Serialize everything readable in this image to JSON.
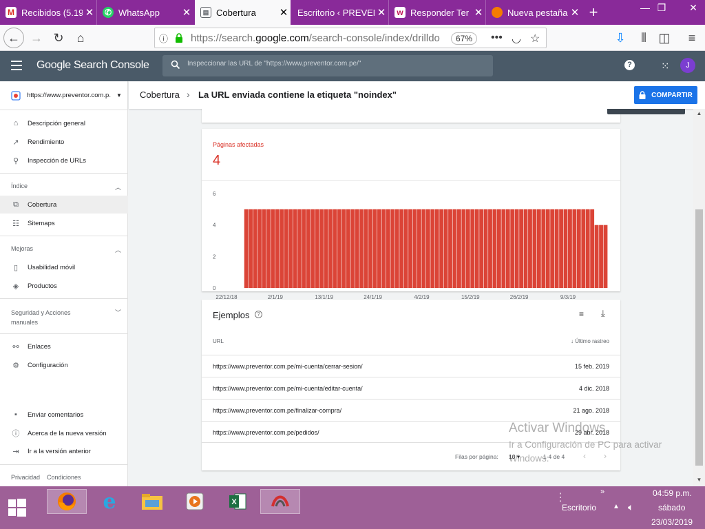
{
  "browser": {
    "tabs": [
      {
        "label": "Recibidos (5.19",
        "icon": "gmail-icon",
        "color": "#ffffff"
      },
      {
        "label": "WhatsApp",
        "icon": "whatsapp-icon",
        "color": "#25d366"
      },
      {
        "label": "Cobertura",
        "icon": "search-console-icon",
        "active": true
      },
      {
        "label": "Escritorio ‹ PREVEN",
        "icon": "wordpress-icon"
      },
      {
        "label": "Responder Ter",
        "icon": "w-icon"
      },
      {
        "label": "Nueva pestaña",
        "icon": "firefox-icon"
      }
    ],
    "url_prefix": "https://search.",
    "url_domain": "google.com",
    "url_rest": "/search-console/index/drilldo",
    "zoom": "67%"
  },
  "gsc": {
    "logo": "Google Search Console",
    "search_placeholder": "Inspeccionar las URL de \"https://www.preventor.com.pe/\"",
    "avatar": "J"
  },
  "sidebar": {
    "property": "https://www.preventor.com.p...",
    "items_top": [
      {
        "label": "Descripción general",
        "icon": "home-icon"
      },
      {
        "label": "Rendimiento",
        "icon": "trending-up-icon"
      },
      {
        "label": "Inspección de URLs",
        "icon": "search-icon"
      }
    ],
    "section_indice": "Índice",
    "items_indice": [
      {
        "label": "Cobertura",
        "icon": "coverage-icon",
        "active": true
      },
      {
        "label": "Sitemaps",
        "icon": "sitemap-icon"
      }
    ],
    "section_mejoras": "Mejoras",
    "items_mejoras": [
      {
        "label": "Usabilidad móvil",
        "icon": "mobile-icon"
      },
      {
        "label": "Productos",
        "icon": "layers-icon"
      }
    ],
    "section_seguridad_1": "Seguridad y Acciones",
    "section_seguridad_2": "manuales",
    "items_other": [
      {
        "label": "Enlaces",
        "icon": "links-icon"
      },
      {
        "label": "Configuración",
        "icon": "gear-icon"
      }
    ],
    "items_bottom": [
      {
        "label": "Enviar comentarios",
        "icon": "feedback-icon"
      },
      {
        "label": "Acerca de la nueva versión",
        "icon": "info-icon"
      },
      {
        "label": "Ir a la versión anterior",
        "icon": "exit-icon"
      }
    ],
    "footer_privacy": "Privacidad",
    "footer_terms": "Condiciones"
  },
  "breadcrumb": {
    "parent": "Cobertura",
    "current": "La URL enviada contiene la etiqueta \"noindex\"",
    "share_label": "COMPARTIR"
  },
  "affected": {
    "label": "Páginas afectadas",
    "value": "4"
  },
  "chart_data": {
    "type": "bar",
    "color": "#db4437",
    "ylim": [
      0,
      6
    ],
    "yticks": [
      0,
      2,
      4,
      6
    ],
    "xticks": [
      "22/12/18",
      "2/1/19",
      "13/1/19",
      "24/1/19",
      "4/2/19",
      "15/2/19",
      "26/2/19",
      "9/3/19"
    ],
    "start_date": "2018-12-22",
    "values": [
      0,
      0,
      0,
      0,
      5,
      5,
      5,
      5,
      5,
      5,
      5,
      5,
      5,
      5,
      5,
      5,
      5,
      5,
      5,
      5,
      5,
      5,
      5,
      5,
      5,
      5,
      5,
      5,
      5,
      5,
      5,
      5,
      5,
      5,
      5,
      5,
      5,
      5,
      5,
      5,
      5,
      5,
      5,
      5,
      5,
      5,
      5,
      5,
      5,
      5,
      5,
      5,
      5,
      5,
      5,
      5,
      5,
      5,
      5,
      5,
      5,
      5,
      5,
      5,
      5,
      5,
      5,
      5,
      5,
      5,
      5,
      5,
      5,
      5,
      5,
      5,
      5,
      5,
      5,
      5,
      5,
      5,
      5,
      4,
      4,
      4
    ]
  },
  "examples": {
    "title": "Ejemplos",
    "col_url": "URL",
    "col_date": "Último rastreo",
    "rows": [
      {
        "url": "https://www.preventor.com.pe/mi-cuenta/cerrar-sesion/",
        "date": "15 feb. 2019"
      },
      {
        "url": "https://www.preventor.com.pe/mi-cuenta/editar-cuenta/",
        "date": "4 dic. 2018"
      },
      {
        "url": "https://www.preventor.com.pe/finalizar-compra/",
        "date": "21 ago. 2018"
      },
      {
        "url": "https://www.preventor.com.pe/pedidos/",
        "date": "29 abr. 2018"
      }
    ],
    "rows_per_page_label": "Filas por página:",
    "rows_per_page": "10",
    "range": "1-4 de 4"
  },
  "watermark": {
    "line1": "Activar Windows",
    "line2": "Ir a Configuración de PC para activar Windows."
  },
  "taskbar": {
    "desktop_label": "Escritorio",
    "time": "04:59 p.m.",
    "day": "sábado",
    "date": "23/03/2019"
  }
}
